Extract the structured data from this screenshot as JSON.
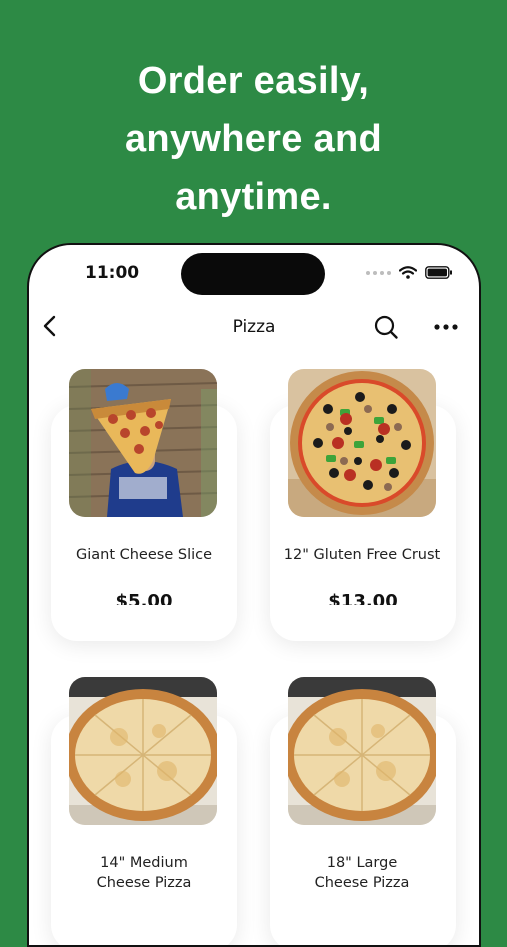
{
  "hero": {
    "line1": "Order easily,",
    "line2": "anywhere and",
    "line3": "anytime."
  },
  "status_bar": {
    "time": "11:00"
  },
  "nav": {
    "title": "Pizza",
    "back_icon": "chevron-left-icon",
    "search_icon": "search-icon",
    "more_icon": "more-horizontal-icon"
  },
  "products": [
    {
      "name": "Giant Cheese Slice",
      "price": "$5.00"
    },
    {
      "name": "12\" Gluten Free Crust",
      "price": "$13.00"
    },
    {
      "name_line1": "14\" Medium",
      "name_line2": "Cheese Pizza"
    },
    {
      "name_line1": "18\" Large",
      "name_line2": "Cheese Pizza"
    }
  ],
  "colors": {
    "background": "#2d8a45",
    "hero_text": "#ffffff",
    "phone_surface": "#ffffff"
  }
}
